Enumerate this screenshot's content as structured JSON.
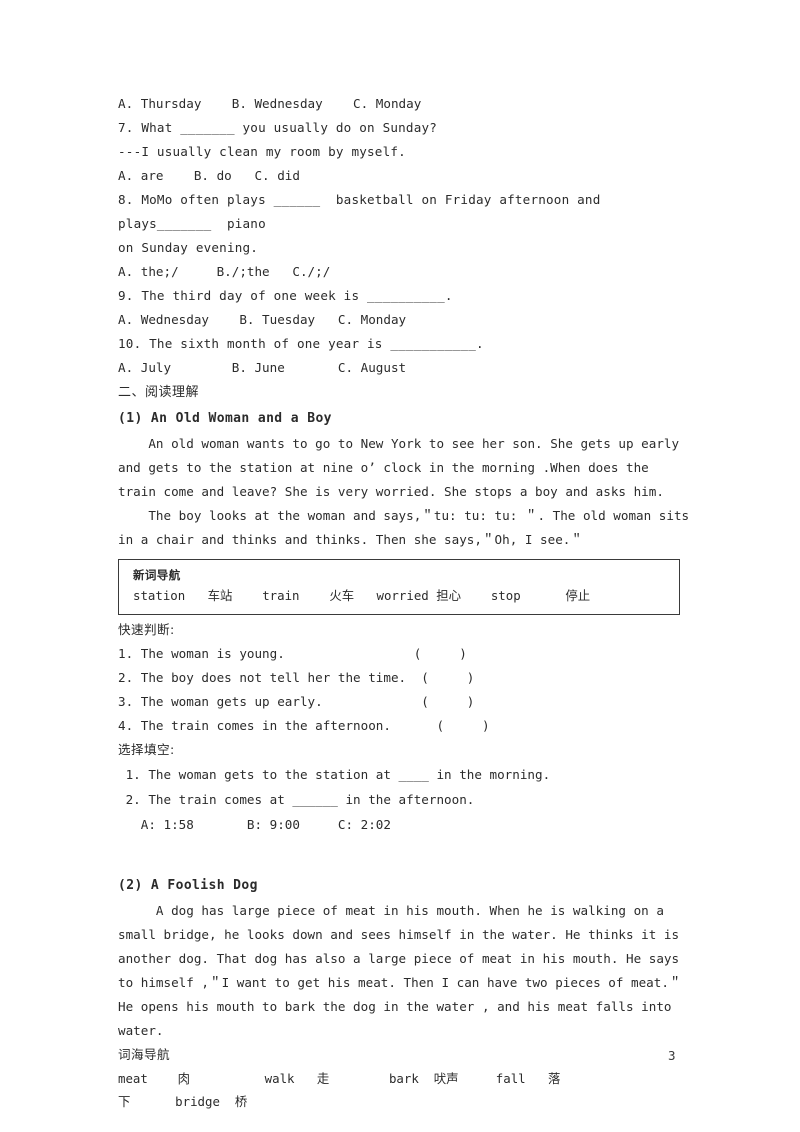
{
  "document": {
    "page_number": "3"
  },
  "part_one_tail": {
    "q6_options": "A. Thursday    B. Wednesday    C. Monday",
    "q7_stem": "7. What _______ you usually do on Sunday?",
    "q7_answer_line": "---I usually clean my room by myself.",
    "q7_options": "A. are    B. do   C. did",
    "q8_stem_line1": "8. MoMo often plays ______  basketball on Friday afternoon and plays_______  piano",
    "q8_stem_line2": "on Sunday evening.",
    "q8_options": "A. the;/     B./;the   C./;/",
    "q9_stem": "9. The third day of one week is __________.",
    "q9_options": "A. Wednesday    B. Tuesday   C. Monday",
    "q10_stem": "10. The sixth month of one year is ___________.",
    "q10_options": "A. July        B. June       C. August"
  },
  "part_two": {
    "heading": "二、阅读理解",
    "passage_one": {
      "title": "(1) An Old Woman and a Boy",
      "para1": "    An old woman wants to go to New York to see her son. She gets up early and gets to the station at nine o’ clock in the morning .When does the train come and leave? She is very worried. She stops a boy and asks him.",
      "para2": "    The boy looks at the woman and says,＂tu: tu: tu: ＂. The old woman sits in a chair and thinks and thinks. Then she says,＂Oh, I see.＂",
      "vocab_box": {
        "title": "新词导航",
        "entries": "station   车站    train    火车   worried 担心    stop      停止"
      },
      "tf_label": "快速判断:",
      "tf_items": [
        "1. The woman is young.                 (     )",
        "2. The boy does not tell her the time.  (     )",
        "3. The woman gets up early.             (     )",
        "4. The train comes in the afternoon.      (     )"
      ],
      "fill_label": "选择填空:",
      "fill_items": [
        " 1. The woman gets to the station at ____ in the morning.",
        " 2. The train comes at ______ in the afternoon."
      ],
      "fill_options": "   A: 1:58       B: 9:00     C: 2:02"
    },
    "passage_two": {
      "title": "(2) A  Foolish  Dog",
      "para1": "     A dog has large piece of meat in his mouth. When he is walking on a small bridge, he looks down and sees himself in the water. He thinks it is another dog. That dog has also a large piece of meat in his mouth. He says to himself ,＂I want to get his meat. Then I can have two pieces of meat.＂ He opens his mouth to bark the dog in the water , and his meat falls into water.",
      "vocab_title": "词海导航",
      "vocab_line1": "meat    肉          walk   走        bark  吠声     fall   落",
      "vocab_line2": "下      bridge  桥"
    }
  }
}
